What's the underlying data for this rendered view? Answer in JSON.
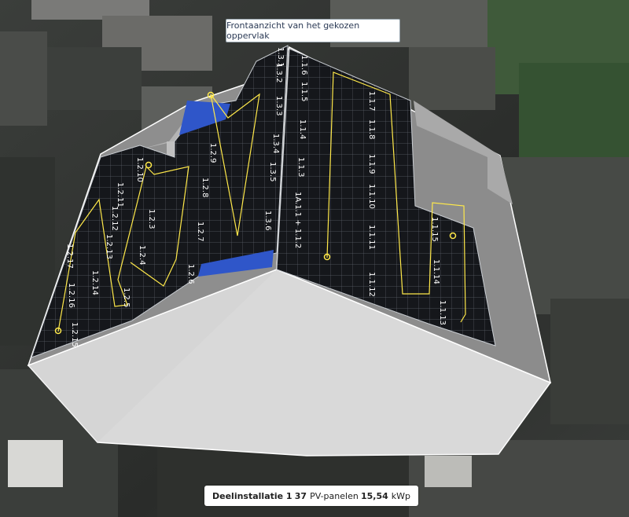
{
  "tooltip": {
    "text": "Frontaanzicht van het gekozen oppervlak"
  },
  "status": {
    "installation": "Deelinstallatie 1",
    "panel_count": "37",
    "panel_unit": "PV-panelen",
    "power_value": "15,54",
    "power_unit": "kWp"
  },
  "left_face_labels": {
    "c1": [
      "1.2.17",
      "1.2.16",
      "1.2.15"
    ],
    "c2": [
      "1.2.11",
      "1.2.12",
      "1.2.13",
      "1.2.14"
    ],
    "c3": [
      "1.2.10",
      "1.2.9"
    ],
    "c4": [
      "1.2.4",
      "1.2.3",
      "1.2.5"
    ],
    "c5": [
      "1.2.6",
      "1.2.7",
      "1.2.8"
    ],
    "c6": [
      "1.2.9"
    ],
    "c7": [
      "1.3.1",
      "1.3.2",
      "1.3.3",
      "1.3.4",
      "1.3.5",
      "1.3.6"
    ]
  },
  "right_face_labels": {
    "c1": [
      "1.1.6",
      "1.1.5",
      "1.1.4",
      "1.1.3",
      "1A.1.1 + 1.1.2"
    ],
    "c2": [
      "1.1.7",
      "1.1.8",
      "1.1.9",
      "1.1.10",
      "1.1.11",
      "1.1.12"
    ],
    "c3": [
      "1.1.15",
      "1.1.14",
      "1.1.13"
    ]
  },
  "colors": {
    "wall": "#d8d8d8",
    "panel": "#16181c",
    "panel_grid": "#8a8f96",
    "string_line": "#ffe94a",
    "blue_filler": "#2f56c9",
    "roof_gray": "#8c8c8c"
  }
}
